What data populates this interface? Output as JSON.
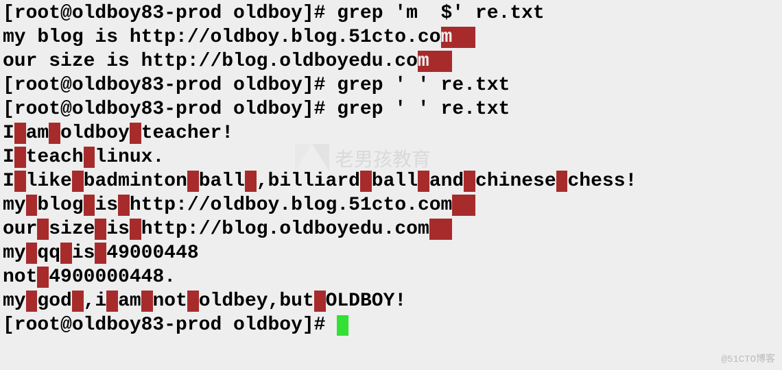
{
  "prompt": "[root@oldboy83-prod oldboy]# ",
  "cmd1": "grep 'm  $' re.txt",
  "cmd2": "grep ' ' re.txt",
  "cmd3": "grep ' ' re.txt",
  "out1_pre": "my blog is http://oldboy.blog.51cto.co",
  "out1_m": "m  ",
  "out2_pre": "our size is http://blog.oldboyedu.co",
  "out2_m": "m  ",
  "l1_a": "I",
  "l1_b": "am",
  "l1_c": "oldboy",
  "l1_d": "teacher!",
  "l2_a": "I",
  "l2_b": "teach",
  "l2_c": "linux.",
  "l3_a": "I",
  "l3_b": "like",
  "l3_c": "badminton",
  "l3_d": "ball",
  "l3_e": ",billiard",
  "l3_f": "ball",
  "l3_g": "and",
  "l3_h": "chinese",
  "l3_i": "chess!",
  "l4_a": "my",
  "l4_b": "blog",
  "l4_c": "is",
  "l4_d": "http://oldboy.blog.51cto.com",
  "l5_a": "our",
  "l5_b": "size",
  "l5_c": "is",
  "l5_d": "http://blog.oldboyedu.com",
  "l6_a": "my",
  "l6_b": "qq",
  "l6_c": "is",
  "l6_d": "49000448",
  "l7_a": "not",
  "l7_b": "4900000448.",
  "l8_a": "my",
  "l8_b": "god",
  "l8_c": ",i",
  "l8_d": "am",
  "l8_e": "not",
  "l8_f": "oldbey,but",
  "l8_g": "OLDBOY!",
  "sp": " ",
  "sp2": "  ",
  "watermark_text": "老男孩教育",
  "credit_text": "@51CTO博客"
}
